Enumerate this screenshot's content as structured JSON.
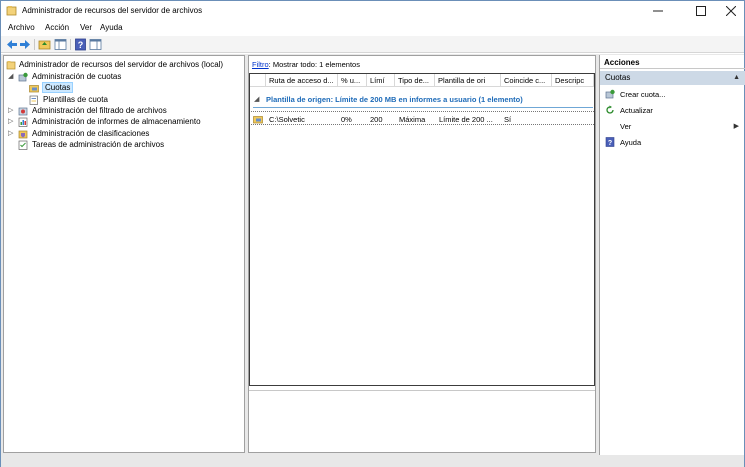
{
  "window": {
    "title": "Administrador de recursos del servidor de archivos"
  },
  "menu": {
    "items": [
      "Archivo",
      "Acción",
      "Ver",
      "Ayuda"
    ]
  },
  "tree": {
    "root": "Administrador de recursos del servidor de archivos (local)",
    "quota_mgmt": "Administración de cuotas",
    "quotas": "Cuotas",
    "quota_templates": "Plantillas de cuota",
    "file_screening": "Administración del filtrado de archivos",
    "storage_reports": "Administración de informes de almacenamiento",
    "classification": "Administración de clasificaciones",
    "file_tasks": "Tareas de administración de archivos"
  },
  "center": {
    "filter_link": "Filtro",
    "filter_text": ": Mostrar todo: 1 elementos",
    "columns": [
      "Ruta de acceso d...",
      "% u...",
      "Límí",
      "Tipo de...",
      "Plantilla de ori",
      "Coincide c...",
      "Descripc"
    ],
    "group_title": "Plantilla de origen: Límite de 200 MB en informes a usuario (1 elemento)",
    "row": {
      "path": "C:\\Solvetic",
      "percent": "0%",
      "limit": "200",
      "type": "Máxima",
      "template": "Límite de 200 ...",
      "match": "Sí",
      "description": ""
    }
  },
  "actions": {
    "header": "Acciones",
    "section": "Cuotas",
    "items": [
      "Crear cuota...",
      "Actualizar",
      "Ver",
      "Ayuda"
    ]
  },
  "colors": {
    "group_title": "#1e6bb8",
    "section_bg": "#cdd9e6",
    "selection_bg": "#cce8ff"
  }
}
